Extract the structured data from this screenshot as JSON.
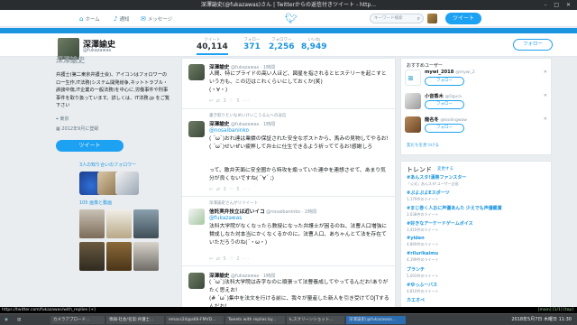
{
  "window_title": "深澤諭史(@fukazawas)さん | Twitterからの返信付きツイート - http...",
  "nav": {
    "home": "ホーム",
    "notifications": "通知",
    "messages": "メッセージ",
    "search_placeholder": "キーワード検索",
    "tweet": "ツイート"
  },
  "profile": {
    "name": "深澤諭史",
    "handle": "@fukazawas",
    "bigname": "深澤諭史",
    "bio": "弁護士(第二東京弁護士会)、アイコンはフォロワーのロー生作,IT法務(システム開発紛争,ネットトラブル・誹謗中傷,IT企業の一般法務)を中心に,労働事件や刑事事件を取り扱っています。詳しくは、IT法務.jp をご覧下さい",
    "location": "東京",
    "joined": "2012年9月に登録",
    "tweet_button": "ツイート",
    "followers_you_know": "3人の知り合いのフォロワー",
    "media": "105 画像と動画"
  },
  "stats": [
    {
      "label": "ツイート",
      "value": "40,114"
    },
    {
      "label": "フォロー",
      "value": "371"
    },
    {
      "label": "フォロワー",
      "value": "2,256"
    },
    {
      "label": "いいね",
      "value": "8,949"
    }
  ],
  "follow_button": "フォロー",
  "tweets": [
    {
      "name": "深澤諭史",
      "meta": "@fukazawas · 1時間",
      "text": "人間、特にプライドの高い人ほど、図星を指されるとヒステリーを起こすという方も、この辺はこれくらいにしておくか(笑)\n(・∀・)",
      "actions": "↩  ⇄ 3  ♡ 5  ···"
    },
    {
      "context": "書き取りたいなめいけいこうるんへの返信",
      "name": "深澤諭史",
      "meta": "@fukazawas · 1時間",
      "reply_to": "@nosaibaninko",
      "text": "( ´ω`)おれ達は業績の保証された安全なポストから、馬みの見物してやるお!\n( ´ω`)せいぜい疲弊して弁士に仕生できるよう祈っててるお!感謝しろ",
      "text2": "って、敵弁天面に安全圏から特攻を煽っていた連中を連想させて、あまり気分が良くないですね( `∀´ ;)",
      "actions": "↩  ⇄ 3  ♡ 5  ···"
    },
    {
      "context": "深澤諭史さんがリツイート",
      "name": "信託実弁技立は近いイコ",
      "meta": "@nosaibaninko · 1時間",
      "reply_to": "@fukazawas",
      "text": "法科大学院がなくなったら教授になった弁護士が困るのね、法曹人口増強に賛成しなた対本当にかくなくるかのに。法曹人口、あちゃんとて法を存在ていただろうのね(´・ω・)",
      "actions": "↩  ⇄ 5  ♡ 2  ···"
    },
    {
      "name": "深澤諭史",
      "meta": "@fukazawas · 1時間",
      "text": "( ´ω`)法科大学院は赤字なのに頑張って法曹養成してやってるんだお!ありがたく思えお!\n(# ´ω`)集中を法文を行ける前に、我々が量産した新人を引き受けてOJTするんだお!",
      "actions": ""
    }
  ],
  "suggestions_title": "おすすめユーザー",
  "suggestions": [
    {
      "name": "mywi_2018",
      "handle": "@mywi_2",
      "follow": "フォロー"
    },
    {
      "name": "小音香木",
      "handle": "@Ogura",
      "follow": "フォロー"
    },
    {
      "name": "龍名冬",
      "handle": "@loolingwaw",
      "follow": "フォロー"
    }
  ],
  "suggestions_more": "友だちを見つける",
  "trends_title": "トレンド",
  "trends_change": "変更する",
  "trends": [
    {
      "tag": "#あんスタ!漢祭ファンスター",
      "count": "「公式」あんスタ!ユーザー企画"
    },
    {
      "tag": "#ぷよぷよEスポ一ツ",
      "count": "1,179件のツイート"
    },
    {
      "tag": "#まじ巻く人おに声優あんた 少えでも声優鑑賞",
      "count": "3,038件のツイート"
    },
    {
      "tag": "#好きなアーケードゲームボイス",
      "count": "3,410件のツイート"
    },
    {
      "tag": "#yiden",
      "count": "4,869件のツイート"
    },
    {
      "tag": "#rilurikaimu",
      "count": "4,199件のツイート"
    },
    {
      "tag": "ブランチ",
      "count": "5,003件のツイート"
    },
    {
      "tag": "#ゆっふーバス",
      "count": "4,810件のツイート"
    },
    {
      "tag": "カエオペ",
      "count": ""
    }
  ],
  "statusbar": {
    "url": "https://twitter.com/fukazawas/with_replies [+]",
    "right": "[main]  [1/1]  [top]"
  },
  "taskbar": [
    {
      "label": "カメラアプロード..."
    },
    {
      "label": "専鍋·社会/名案:弁護士..."
    },
    {
      "label": "emacs24@a66-FMVD..."
    },
    {
      "label": "Tweets with replies by..."
    },
    {
      "label": "k,スクリーンショット..."
    },
    {
      "label": "深澤諭史(@fukazawas..."
    }
  ],
  "clock": "2018年5月7日 木曜日  11:30"
}
